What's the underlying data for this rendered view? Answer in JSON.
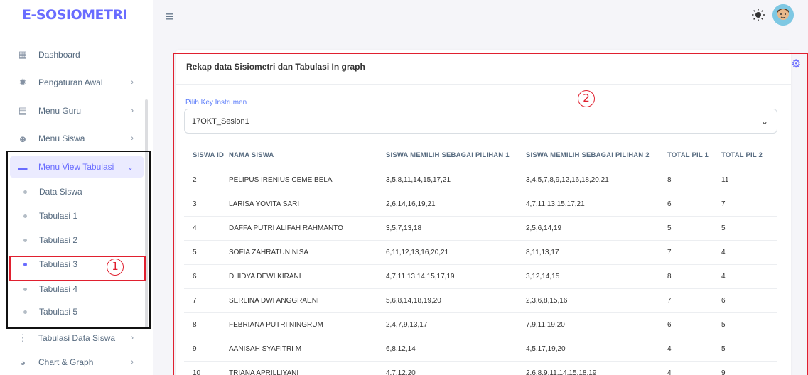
{
  "app": {
    "brand": "E-SOSIOMETRI"
  },
  "sidebar": {
    "items": [
      {
        "label": "Dashboard",
        "icon": "dashboard-icon",
        "arrow": ""
      },
      {
        "label": "Pengaturan Awal",
        "icon": "settings-icon",
        "arrow": "›"
      },
      {
        "label": "Menu Guru",
        "icon": "document-icon",
        "arrow": "›"
      },
      {
        "label": "Menu Siswa",
        "icon": "user-icon",
        "arrow": "›"
      },
      {
        "label": "Menu View Tabulasi",
        "icon": "table-icon",
        "arrow": "⌄"
      }
    ],
    "sub_items": [
      {
        "label": "Data Siswa"
      },
      {
        "label": "Tabulasi 1"
      },
      {
        "label": "Tabulasi 2"
      },
      {
        "label": "Tabulasi 3"
      },
      {
        "label": "Tabulasi 4"
      },
      {
        "label": "Tabulasi 5"
      }
    ],
    "bottom_items": [
      {
        "label": "Tabulasi Data Siswa",
        "icon": "tree-icon",
        "arrow": "›"
      },
      {
        "label": "Chart & Graph",
        "icon": "pie-chart-icon",
        "arrow": "›"
      }
    ]
  },
  "annotations": {
    "one": "1",
    "two": "2"
  },
  "card": {
    "title": "Rekap data Sisiometri dan Tabulasi In graph",
    "select_label": "Pilih Key Instrumen",
    "select_value": "17OKT_Sesion1"
  },
  "table": {
    "headers": [
      "SISWA ID",
      "NAMA SISWA",
      "SISWA MEMILIH SEBAGAI PILIHAN 1",
      "SISWA MEMILIH SEBAGAI PILIHAN 2",
      "TOTAL PIL 1",
      "TOTAL PIL 2"
    ],
    "rows": [
      [
        "2",
        "PELIPUS IRENIUS CEME BELA",
        "3,5,8,11,14,15,17,21",
        "3,4,5,7,8,9,12,16,18,20,21",
        "8",
        "11"
      ],
      [
        "3",
        "LARISA YOVITA SARI",
        "2,6,14,16,19,21",
        "4,7,11,13,15,17,21",
        "6",
        "7"
      ],
      [
        "4",
        "DAFFA PUTRI ALIFAH RAHMANTO",
        "3,5,7,13,18",
        "2,5,6,14,19",
        "5",
        "5"
      ],
      [
        "5",
        "SOFIA ZAHRATUN NISA",
        "6,11,12,13,16,20,21",
        "8,11,13,17",
        "7",
        "4"
      ],
      [
        "6",
        "DHIDYA DEWI KIRANI",
        "4,7,11,13,14,15,17,19",
        "3,12,14,15",
        "8",
        "4"
      ],
      [
        "7",
        "SERLINA DWI ANGGRAENI",
        "5,6,8,14,18,19,20",
        "2,3,6,8,15,16",
        "7",
        "6"
      ],
      [
        "8",
        "FEBRIANA PUTRI NINGRUM",
        "2,4,7,9,13,17",
        "7,9,11,19,20",
        "6",
        "5"
      ],
      [
        "9",
        "AANISAH SYAFITRI M",
        "6,8,12,14",
        "4,5,17,19,20",
        "4",
        "5"
      ],
      [
        "10",
        "TRIANA APRILLIYANI",
        "4,7,12,20",
        "2,6,8,9,11,14,15,18,19",
        "4",
        "9"
      ]
    ]
  }
}
